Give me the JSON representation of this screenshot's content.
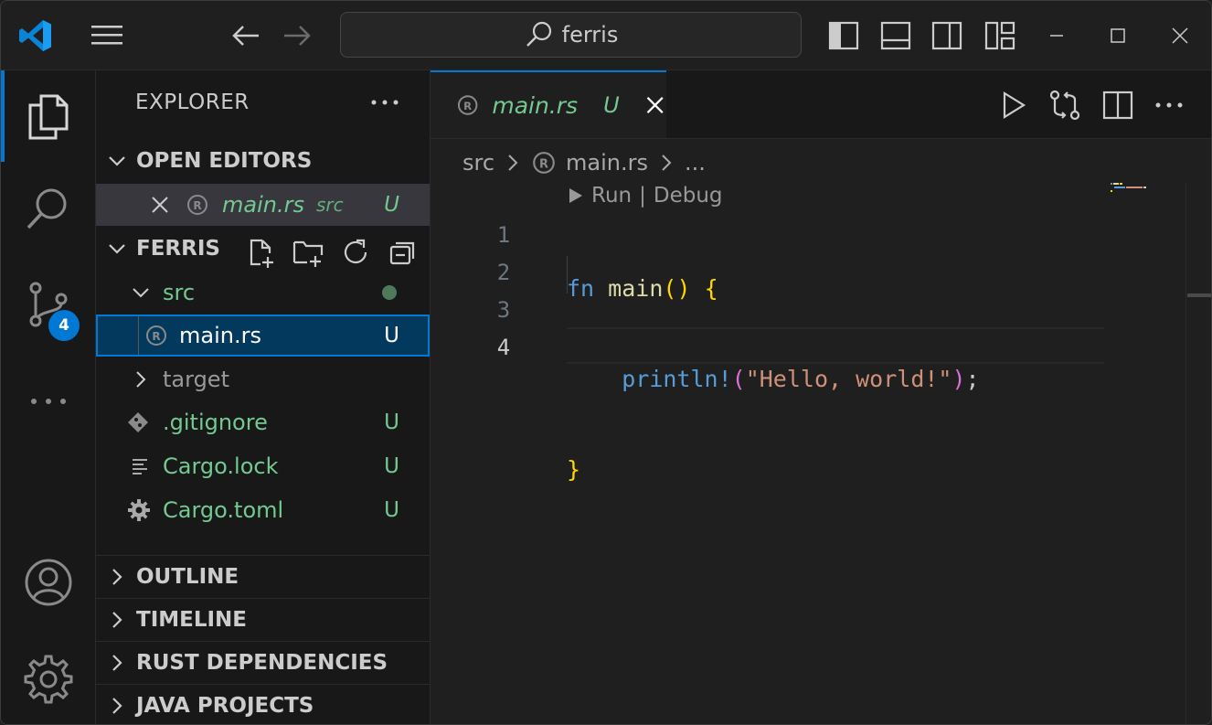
{
  "titlebar": {
    "search_text": "ferris"
  },
  "activity": {
    "scm_badge": "4"
  },
  "sidebar": {
    "title": "EXPLORER",
    "open_editors": {
      "header": "OPEN EDITORS",
      "items": [
        {
          "name": "main.rs",
          "folder": "src",
          "status": "U"
        }
      ]
    },
    "project": {
      "header": "FERRIS",
      "tree": [
        {
          "name": "src",
          "type": "folder",
          "expanded": true
        },
        {
          "name": "main.rs",
          "status": "U",
          "selected": true
        },
        {
          "name": "target",
          "type": "folder",
          "expanded": false
        },
        {
          "name": ".gitignore",
          "status": "U"
        },
        {
          "name": "Cargo.lock",
          "status": "U"
        },
        {
          "name": "Cargo.toml",
          "status": "U"
        }
      ]
    },
    "collapsed_sections": [
      "OUTLINE",
      "TIMELINE",
      "RUST DEPENDENCIES",
      "JAVA PROJECTS"
    ]
  },
  "editor": {
    "tab": {
      "label": "main.rs",
      "status": "U"
    },
    "breadcrumb": {
      "folder": "src",
      "file": "main.rs",
      "more": "..."
    },
    "codelens": {
      "run": "Run",
      "sep": "|",
      "debug": "Debug"
    },
    "line_numbers": [
      "1",
      "2",
      "3",
      "4"
    ],
    "code": {
      "l1_kw": "fn",
      "l1_name": "main",
      "l1_parens": "()",
      "l1_brace": "{",
      "l2_indent": "    ",
      "l2_macro": "println!",
      "l2_open": "(",
      "l2_str": "\"Hello, world!\"",
      "l2_close": ")",
      "l2_semi": ";",
      "l3_brace": "}"
    }
  },
  "colors": {
    "accent": "#0078d4",
    "git_untracked": "#73c991",
    "background": "#1f1f1f",
    "sidebar_bg": "#181818"
  }
}
